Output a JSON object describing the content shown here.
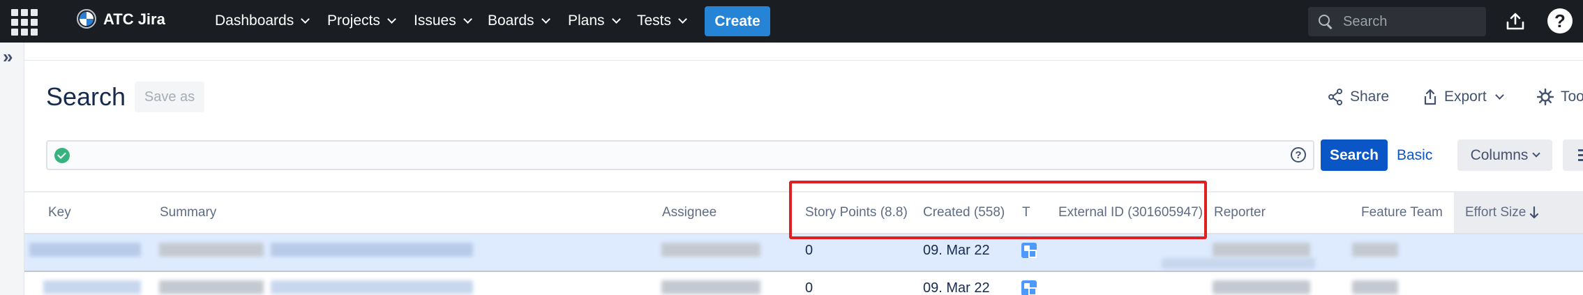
{
  "nav": {
    "brand": "ATC Jira",
    "items": [
      {
        "label": "Dashboards"
      },
      {
        "label": "Projects"
      },
      {
        "label": "Issues"
      },
      {
        "label": "Boards"
      },
      {
        "label": "Plans"
      },
      {
        "label": "Tests"
      }
    ],
    "create_label": "Create",
    "search_placeholder": "Search",
    "help_label": "?"
  },
  "rail": {
    "expand_label": "»"
  },
  "header": {
    "title": "Search",
    "save_as_label": "Save as",
    "share_label": "Share",
    "export_label": "Export",
    "tools_label": "Tools"
  },
  "query": {
    "value": "",
    "help_label": "?",
    "search_label": "Search",
    "basic_label": "Basic",
    "columns_label": "Columns"
  },
  "table": {
    "columns": [
      {
        "label": "Key"
      },
      {
        "label": "Summary"
      },
      {
        "label": "Assignee"
      },
      {
        "label": "Story Points (8.8)"
      },
      {
        "label": "Created (558)"
      },
      {
        "label": "T"
      },
      {
        "label": "External ID (301605947)"
      },
      {
        "label": "Reporter"
      },
      {
        "label": "Feature Team"
      },
      {
        "label": "Effort Size"
      }
    ],
    "rows": [
      {
        "story_points": "0",
        "created": "09. Mar 22",
        "type_icon": "subtask-icon"
      },
      {
        "story_points": "0",
        "created": "09. Mar 22",
        "type_icon": "subtask-icon"
      }
    ]
  },
  "colors": {
    "nav_bg": "#1a1d21",
    "create_bg": "#2684d6",
    "primary": "#0b56c6",
    "row_selected": "#deebff",
    "highlight_border": "#e02020",
    "success": "#36b37e"
  }
}
